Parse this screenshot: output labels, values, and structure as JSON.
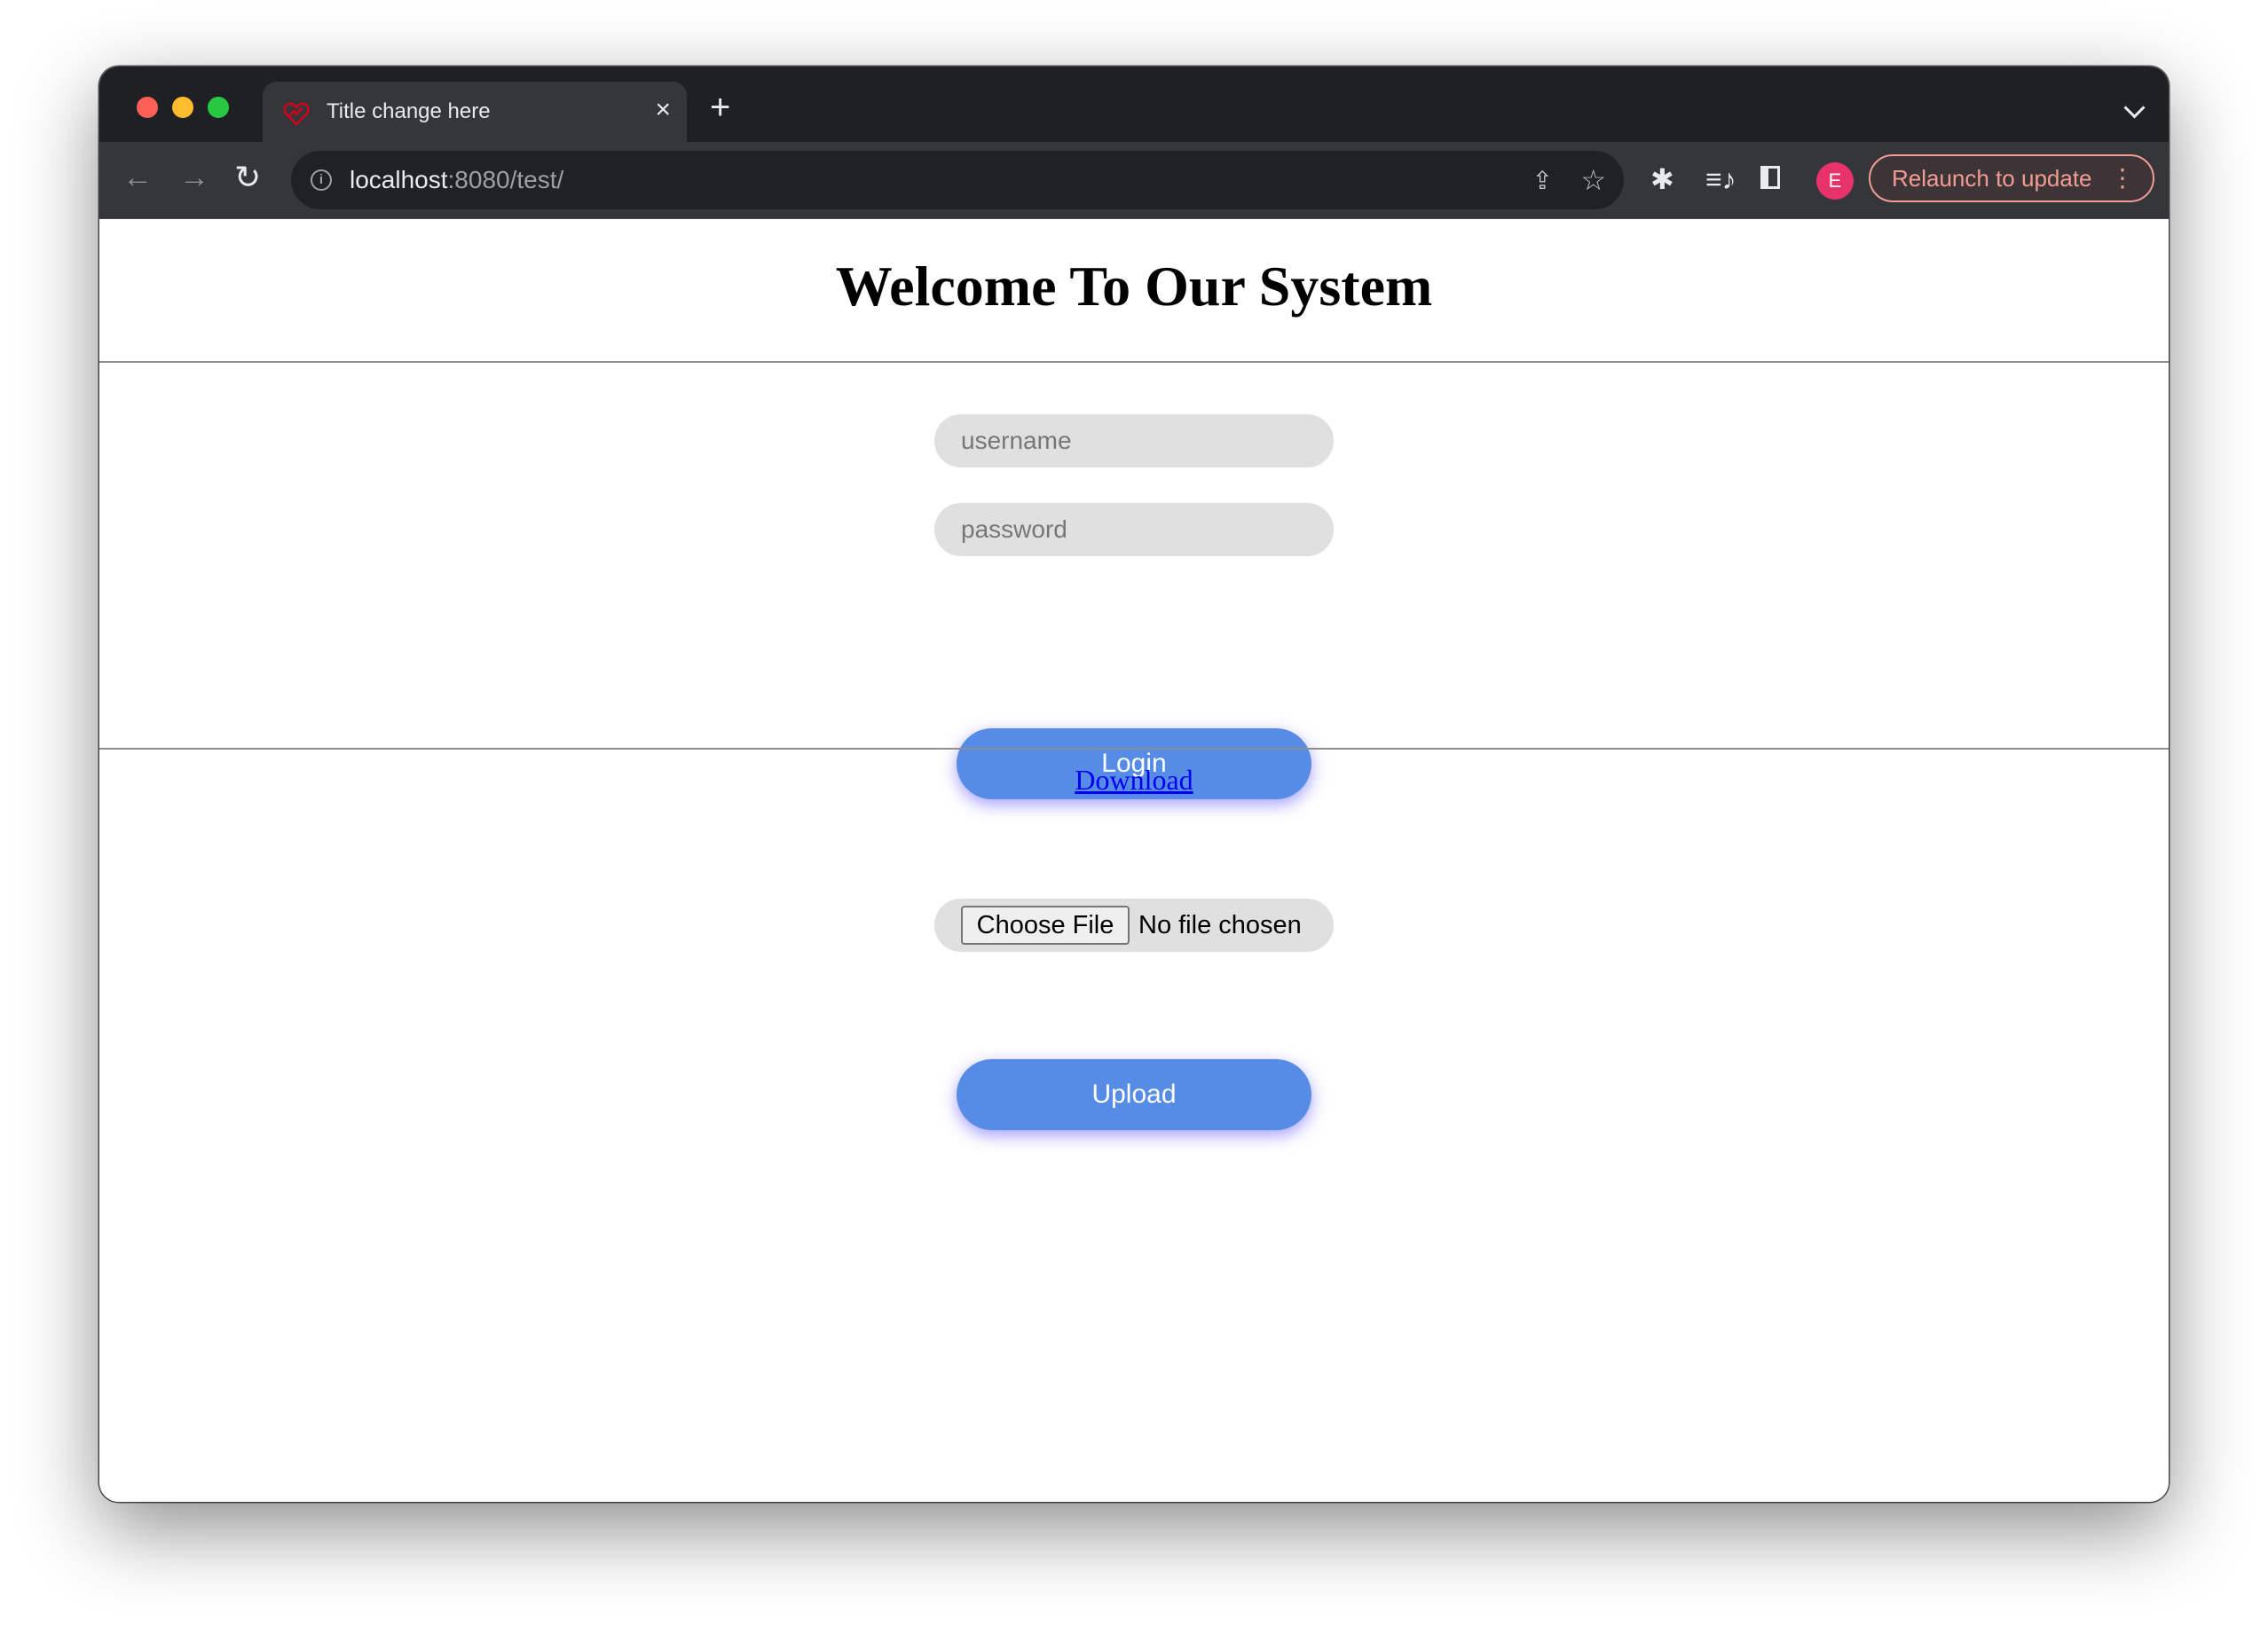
{
  "browser": {
    "tab_title": "Title change here",
    "tab_icon": "heart-pulse-icon",
    "url_host": "localhost",
    "url_rest": ":8080/test/",
    "relaunch_label": "Relaunch to update",
    "profile_initial": "E",
    "icons": {
      "back": "←",
      "forward": "→",
      "reload": "↻",
      "share": "⇪",
      "star": "☆",
      "extensions": "✱",
      "media": "≡♪",
      "menu": "⋮",
      "close": "×",
      "new_tab": "+"
    },
    "colors": {
      "relaunch": "#f29c93",
      "avatar": "#e8336a",
      "tab_icon": "#d0021b"
    }
  },
  "page": {
    "title": "Welcome To Our System",
    "login_form": {
      "username_placeholder": "username",
      "password_placeholder": "password",
      "login_label": "Login"
    },
    "download_link": "Download",
    "upload_form": {
      "choose_file_label": "Choose File",
      "file_status": "No file chosen",
      "upload_label": "Upload"
    },
    "colors": {
      "button": "#568ce5",
      "link": "#0000ee",
      "field_bg": "#e0e0e0"
    }
  }
}
